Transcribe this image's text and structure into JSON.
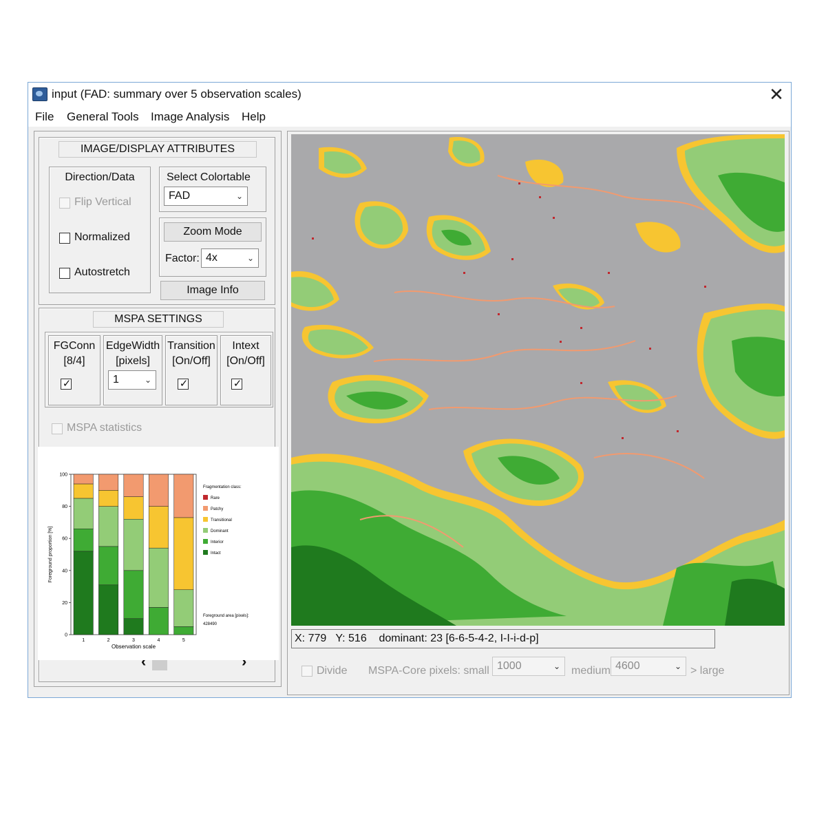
{
  "window": {
    "title": "input (FAD: summary over 5 observation scales)",
    "close_glyph": "✕"
  },
  "menu": [
    "File",
    "General Tools",
    "Image Analysis",
    "Help"
  ],
  "image_display": {
    "heading": "IMAGE/DISPLAY ATTRIBUTES",
    "direction_group": "Direction/Data",
    "flip_vertical": "Flip Vertical",
    "normalized": "Normalized",
    "autostretch": "Autostretch",
    "colortable_group": "Select Colortable",
    "colortable_value": "FAD",
    "zoom_button": "Zoom Mode",
    "factor_label": "Factor:",
    "factor_value": "4x",
    "image_info_button": "Image Info"
  },
  "mspa": {
    "heading": "MSPA SETTINGS",
    "fgconn_label": "FGConn",
    "fgconn_sub": "[8/4]",
    "edgewidth_label": "EdgeWidth",
    "edgewidth_sub": "[pixels]",
    "edgewidth_value": "1",
    "transition_label": "Transition",
    "transition_sub": "[On/Off]",
    "intext_label": "Intext",
    "intext_sub": "[On/Off]",
    "statistics": "MSPA statistics",
    "check_glyph": "✓"
  },
  "scroll": {
    "left": "‹",
    "right": "›"
  },
  "status": {
    "x_label": "X:",
    "x_value": "779",
    "y_label": "Y:",
    "y_value": "516",
    "text": "dominant: 23 [6-6-5-4-2, I-I-i-d-p]"
  },
  "bottom": {
    "divide": "Divide",
    "core_label": "MSPA-Core pixels: small <",
    "small_value": "1000",
    "medium_label": "medium",
    "medium_value": "4600",
    "large_label": "> large"
  },
  "colors": {
    "rare": "#c0282e",
    "patchy": "#f29a6f",
    "transitional": "#f7c531",
    "dominant": "#93cc77",
    "interior": "#3fab34",
    "intact": "#1f7a1e",
    "background": "#a9a9ab"
  },
  "chart_data": {
    "type": "bar",
    "stacked": true,
    "categories": [
      "1",
      "2",
      "3",
      "4",
      "5"
    ],
    "xlabel": "Observation scale",
    "ylabel": "Foreground proportion [%]",
    "ylim": [
      0,
      100
    ],
    "yticks": [
      "0",
      "20",
      "40",
      "60",
      "80",
      "100"
    ],
    "legend_title": "Fragmentation class:",
    "legend_position": "right",
    "series": [
      {
        "name": "Intact",
        "color": "#1f7a1e",
        "values": [
          52,
          31,
          10,
          0,
          0
        ]
      },
      {
        "name": "Interior",
        "color": "#3fab34",
        "values": [
          14,
          24,
          30,
          17,
          5
        ]
      },
      {
        "name": "Dominant",
        "color": "#93cc77",
        "values": [
          19,
          25,
          32,
          37,
          23
        ]
      },
      {
        "name": "Transitional",
        "color": "#f7c531",
        "values": [
          9,
          10,
          14,
          26,
          45
        ]
      },
      {
        "name": "Patchy",
        "color": "#f29a6f",
        "values": [
          6,
          10,
          14,
          20,
          27
        ]
      },
      {
        "name": "Rare",
        "color": "#c0282e",
        "values": [
          0,
          0,
          0,
          0,
          0
        ]
      }
    ],
    "note_label": "Foreground area [pixels]:",
    "note_value": "428490"
  }
}
